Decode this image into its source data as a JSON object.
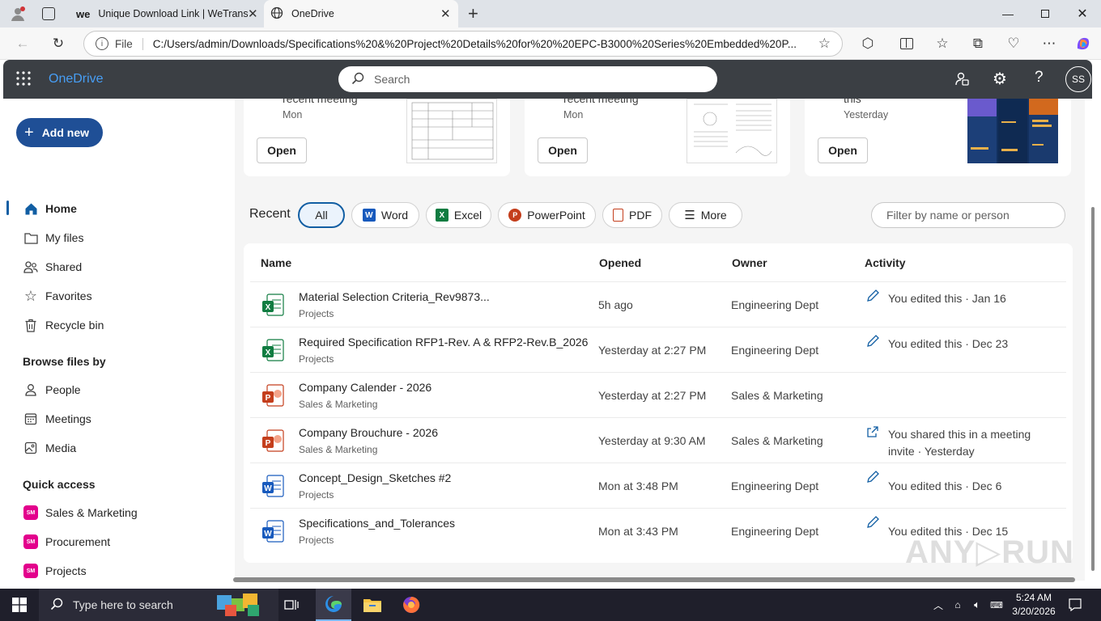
{
  "browser": {
    "tabs": [
      {
        "label": "Unique Download Link | WeTransf",
        "favicon": "wetransfer-icon"
      },
      {
        "label": "OneDrive",
        "favicon": "globe-icon"
      }
    ],
    "address": {
      "scheme_label": "File",
      "url": "C:/Users/admin/Downloads/Specifications%20&%20Project%20Details%20for%20%20EPC-B3000%20Series%20Embedded%20P..."
    }
  },
  "app": {
    "name": "OneDrive",
    "search_placeholder": "Search",
    "avatar_initials": "SS"
  },
  "sidebar": {
    "add_new": "Add new",
    "items": [
      {
        "label": "Home",
        "icon": "home-icon"
      },
      {
        "label": "My files",
        "icon": "folder-icon"
      },
      {
        "label": "Shared",
        "icon": "people-icon"
      },
      {
        "label": "Favorites",
        "icon": "star-icon"
      },
      {
        "label": "Recycle bin",
        "icon": "trash-icon"
      }
    ],
    "browse_heading": "Browse files by",
    "browse": [
      {
        "label": "People",
        "icon": "person-icon"
      },
      {
        "label": "Meetings",
        "icon": "calendar-icon"
      },
      {
        "label": "Media",
        "icon": "image-icon"
      }
    ],
    "quick_heading": "Quick access",
    "quick": [
      {
        "label": "Sales & Marketing",
        "badge": "SM"
      },
      {
        "label": "Procurement",
        "badge": "SM"
      },
      {
        "label": "Projects",
        "badge": "SM"
      }
    ]
  },
  "cards": [
    {
      "cut_text": "recent meeting",
      "sub": "Mon",
      "open": "Open"
    },
    {
      "cut_text": "recent meeting",
      "sub": "Mon",
      "open": "Open"
    },
    {
      "cut_text": "this",
      "sub": "Yesterday",
      "open": "Open"
    }
  ],
  "recent": {
    "label": "Recent",
    "filters": [
      "All",
      "Word",
      "Excel",
      "PowerPoint",
      "PDF",
      "More"
    ],
    "filter_placeholder": "Filter by name or person"
  },
  "table": {
    "headers": [
      "Name",
      "Opened",
      "Owner",
      "Activity"
    ],
    "rows": [
      {
        "type": "excel",
        "name": "Material Selection Criteria_Rev9873...",
        "location": "Projects",
        "opened": "5h ago",
        "owner": "Engineering Dept",
        "activity": "You edited this · Jan 16",
        "activity_icon": "pencil-icon"
      },
      {
        "type": "excel",
        "name": "Required Specification RFP1-Rev. A & RFP2-Rev.B_2026",
        "location": "Projects",
        "opened": "Yesterday at 2:27 PM",
        "owner": "Engineering Dept",
        "activity": "You edited this · Dec 23",
        "activity_icon": "pencil-icon"
      },
      {
        "type": "powerpoint",
        "name": "Company Calender - 2026",
        "location": "Sales & Marketing",
        "opened": "Yesterday at 2:27 PM",
        "owner": "Sales & Marketing",
        "activity": "",
        "activity_icon": ""
      },
      {
        "type": "powerpoint",
        "name": "Company Brouchure - 2026",
        "location": "Sales & Marketing",
        "opened": "Yesterday at 9:30 AM",
        "owner": "Sales & Marketing",
        "activity": "You shared this in a meeting invite · Yesterday",
        "activity_icon": "share-icon"
      },
      {
        "type": "word",
        "name": "Concept_Design_Sketches #2",
        "location": "Projects",
        "opened": "Mon at 3:48 PM",
        "owner": "Engineering Dept",
        "activity": "You edited this · Dec 6",
        "activity_icon": "pencil-icon"
      },
      {
        "type": "word",
        "name": "Specifications_and_Tolerances",
        "location": "Projects",
        "opened": "Mon at 3:43 PM",
        "owner": "Engineering Dept",
        "activity": "You edited this · Dec 15",
        "activity_icon": "pencil-icon"
      }
    ]
  },
  "taskbar": {
    "search_placeholder": "Type here to search",
    "time": "5:24 AM",
    "date": "3/20/2026"
  },
  "colors": {
    "accent": "#115ea3",
    "header": "#3b3f44",
    "add_new": "#1f4f96",
    "excel": "#107c41",
    "word": "#185abd",
    "powerpoint": "#c43e1c",
    "quick_badge": "#e3008c"
  }
}
